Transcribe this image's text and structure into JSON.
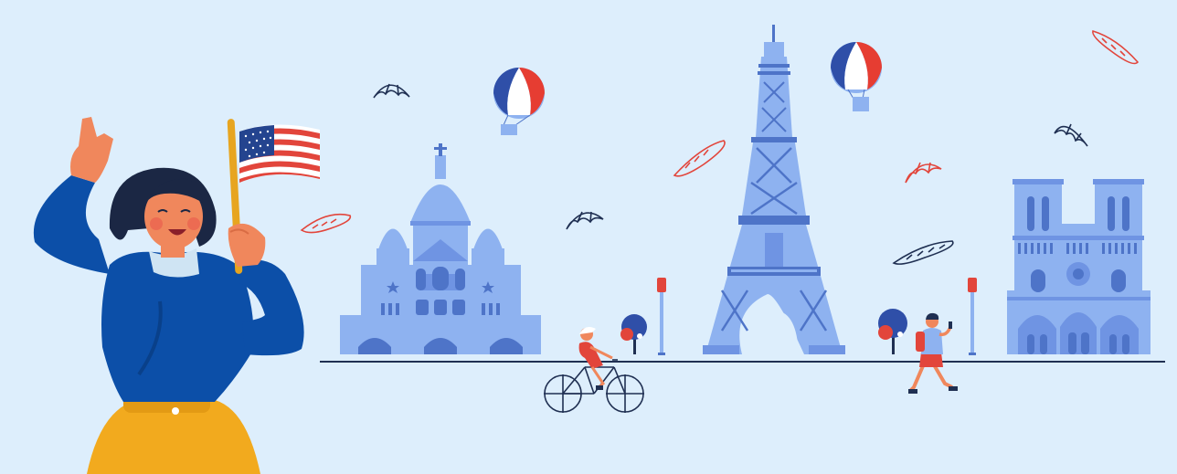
{
  "scene": {
    "subject": "woman-waving-us-flag-with-paris-landmarks",
    "icons": [
      "us-flag-icon",
      "hot-air-balloon-icon",
      "croissant-icon",
      "baguette-icon",
      "eiffel-tower-icon",
      "sacre-coeur-icon",
      "notre-dame-icon",
      "bicycle-icon",
      "street-lamp-icon",
      "tree-icon"
    ]
  },
  "colors": {
    "background": "#ddeefc",
    "building": "#8eb2f0",
    "building_dark": "#4e74c8",
    "building_shade": "#6f94e3",
    "ground_line": "#1f2f52",
    "sweater": "#0c4fa8",
    "skirt": "#f2aa1e",
    "skin": "#f0875c",
    "hair": "#1b2744",
    "flag_red": "#e2453b",
    "flag_blue": "#24448f",
    "balloon_blue": "#2f4fa8",
    "balloon_red": "#e63d32",
    "doodle_red": "#e2453b",
    "doodle_navy": "#1f2f52"
  }
}
